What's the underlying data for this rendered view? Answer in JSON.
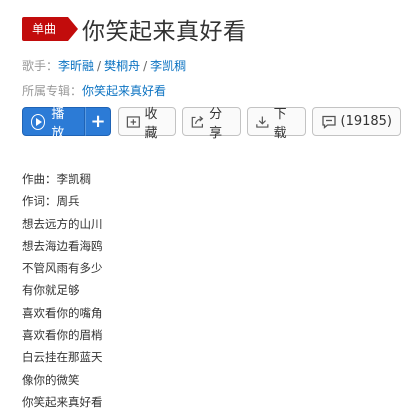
{
  "header": {
    "badge": "单曲",
    "title": "你笑起来真好看"
  },
  "meta": {
    "singer_label": "歌手：",
    "singers": [
      "李昕融",
      "樊桐舟",
      "李凯稠"
    ],
    "separator": "/",
    "album_label": "所属专辑：",
    "album": "你笑起来真好看"
  },
  "actions": {
    "play": "播放",
    "add": "+",
    "collect": "收藏",
    "share": "分享",
    "download": "下载",
    "comment": "(19185)"
  },
  "lyrics": [
    "作曲：李凯稠",
    "作词：周兵",
    "想去远方的山川",
    "想去海边看海鸥",
    "不管风雨有多少",
    "有你就足够",
    "喜欢看你的嘴角",
    "喜欢看你的眉梢",
    "白云挂在那蓝天",
    "像你的微笑",
    "你笑起来真好看"
  ],
  "colors": {
    "accent": "#2c7bd6",
    "badge": "#c20c0c",
    "link": "#0c73c2"
  }
}
